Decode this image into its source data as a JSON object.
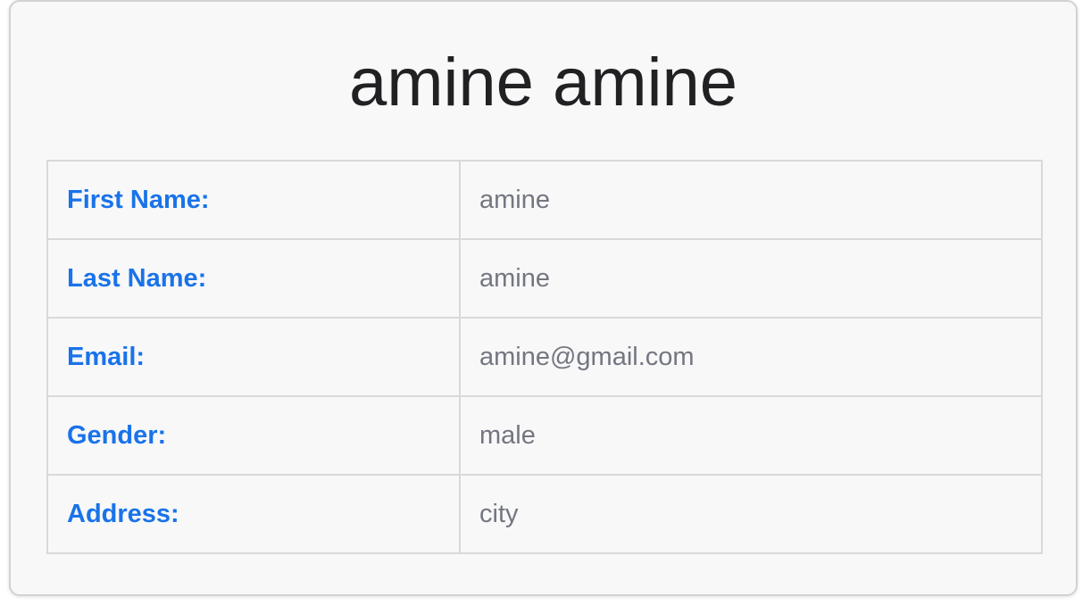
{
  "profile": {
    "title": "amine amine",
    "rows": [
      {
        "label": "First Name:",
        "value": "amine"
      },
      {
        "label": "Last Name:",
        "value": "amine"
      },
      {
        "label": "Email:",
        "value": "amine@gmail.com"
      },
      {
        "label": "Gender:",
        "value": "male"
      },
      {
        "label": "Address:",
        "value": "city"
      }
    ]
  },
  "colors": {
    "label": "#1a73e8",
    "value": "#747680",
    "title": "#212124",
    "card_background": "#f8f8f9",
    "border": "#d9d9dc"
  }
}
